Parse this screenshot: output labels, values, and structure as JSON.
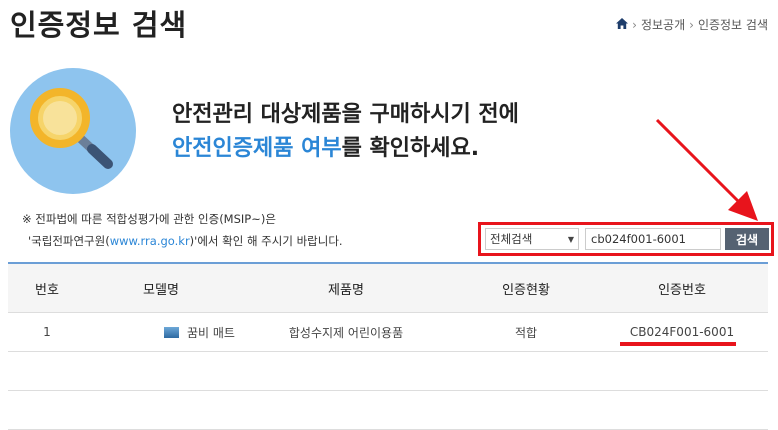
{
  "header": {
    "title": "인증정보 검색",
    "breadcrumb": [
      "정보공개",
      "인증정보 검색"
    ]
  },
  "hero": {
    "line1": "안전관리 대상제품을 구매하시기 전에",
    "line2_accent": "안전인증제품 여부",
    "line2_rest": "를 확인하세요."
  },
  "note": {
    "line1": "※ 전파법에 따른 적합성평가에 관한 인증(MSIP~)은",
    "line2_pre": "'국립전파연구원(",
    "line2_link": "www.rra.go.kr",
    "line2_post": ")'에서 확인 해 주시기 바랍니다."
  },
  "search": {
    "select_value": "전체검색",
    "input_value": "cb024f001-6001",
    "button_label": "검색"
  },
  "table": {
    "headers": [
      "번호",
      "모델명",
      "제품명",
      "인증현황",
      "인증번호"
    ],
    "rows": [
      {
        "num": "1",
        "model": "꿈비 매트",
        "product": "합성수지제 어린이용품",
        "status": "적합",
        "certno": "CB024F001-6001"
      }
    ]
  },
  "colors": {
    "accent": "#2b86d6",
    "highlight": "#e8141c",
    "button": "#556272"
  }
}
